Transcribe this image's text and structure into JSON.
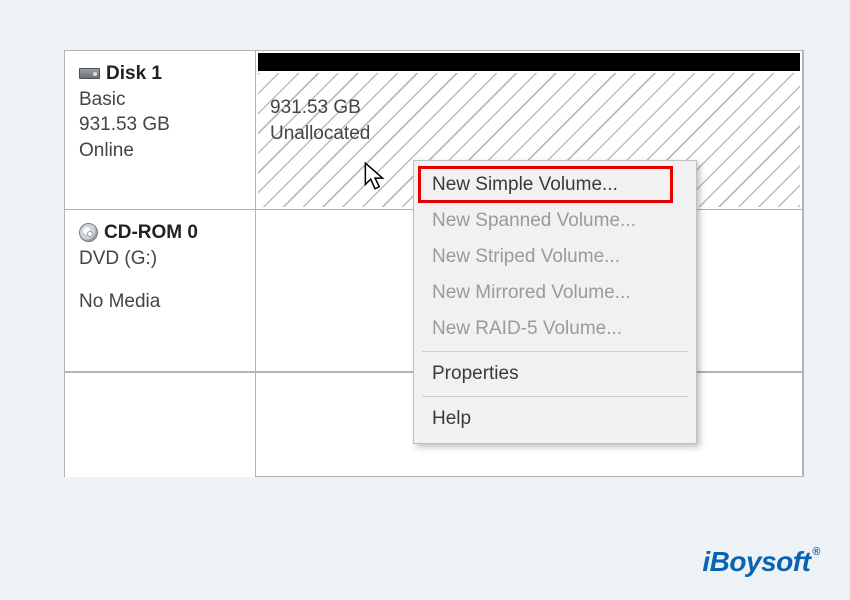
{
  "disks": {
    "disk1": {
      "name": "Disk 1",
      "type": "Basic",
      "size": "931.53 GB",
      "status": "Online",
      "volume": {
        "size": "931.53 GB",
        "state": "Unallocated"
      }
    },
    "cdrom": {
      "name": "CD-ROM 0",
      "type": "DVD (G:)",
      "status": "No Media"
    }
  },
  "context_menu": {
    "items": [
      {
        "label": "New Simple Volume...",
        "enabled": true,
        "highlighted": true
      },
      {
        "label": "New Spanned Volume...",
        "enabled": false
      },
      {
        "label": "New Striped Volume...",
        "enabled": false
      },
      {
        "label": "New Mirrored Volume...",
        "enabled": false
      },
      {
        "label": "New RAID-5 Volume...",
        "enabled": false
      }
    ],
    "properties_label": "Properties",
    "help_label": "Help"
  },
  "watermark": "iBoysoft"
}
